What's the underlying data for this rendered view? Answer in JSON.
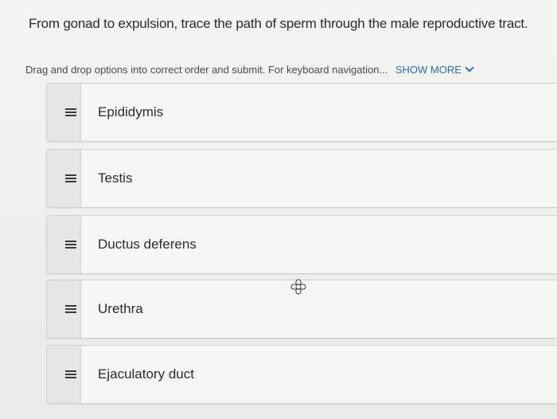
{
  "question": {
    "text": "From gonad to expulsion, trace the path of sperm through the male reproductive tract."
  },
  "instructions": {
    "text": "Drag and drop options into correct order and submit. For keyboard navigation...",
    "show_more_label": "SHOW MORE"
  },
  "options": [
    {
      "label": "Epididymis"
    },
    {
      "label": "Testis"
    },
    {
      "label": "Ductus deferens"
    },
    {
      "label": "Urethra"
    },
    {
      "label": "Ejaculatory duct"
    }
  ],
  "icons": {
    "drag_handle": "drag-handle-icon",
    "show_more": "chevron-down-icon",
    "cursor": "move-cursor-icon"
  },
  "colors": {
    "link": "#2f6fb3",
    "background": "#f0f0ee",
    "item_border": "#cfcfcb"
  }
}
